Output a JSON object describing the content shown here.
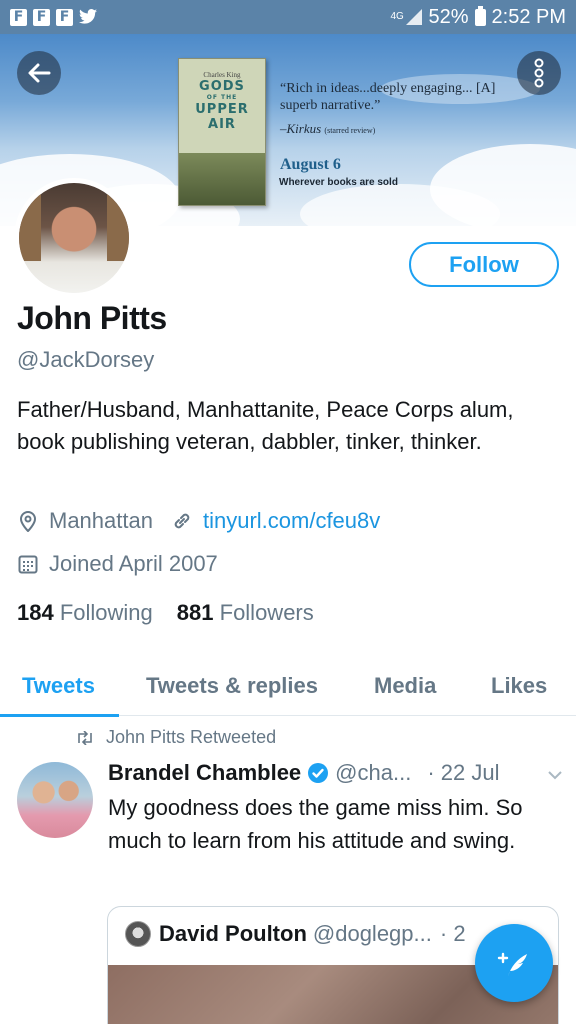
{
  "status_bar": {
    "app_icons": [
      "F",
      "F",
      "F"
    ],
    "network": "4G",
    "battery": "52%",
    "time": "2:52 PM"
  },
  "banner": {
    "book_author": "Charles King",
    "book_title_lines": [
      "GODS",
      "OF THE",
      "UPPER",
      "AIR"
    ],
    "quote": "“Rich in ideas...deeply engaging... [A] superb narrative.”",
    "quote_source": "–Kirkus",
    "quote_source_note": "(starred review)",
    "release_date": "August 6",
    "availability": "Wherever books are sold"
  },
  "profile": {
    "name": "John Pitts",
    "handle": "@JackDorsey",
    "follow_label": "Follow",
    "bio": "Father/Husband, Manhattanite, Peace Corps alum, book publishing veteran, dabbler, tinker, thinker.",
    "location": "Manhattan",
    "website": "tinyurl.com/cfeu8v",
    "joined": "Joined April 2007",
    "following_count": "184",
    "following_label": "Following",
    "followers_count": "881",
    "followers_label": "Followers"
  },
  "tabs": [
    {
      "label": "Tweets",
      "active": true
    },
    {
      "label": "Tweets & replies",
      "active": false
    },
    {
      "label": "Media",
      "active": false
    },
    {
      "label": "Likes",
      "active": false
    }
  ],
  "tweet": {
    "retweet_context": "John Pitts Retweeted",
    "author_name": "Brandel Chamblee",
    "author_handle": "@cha...",
    "time": "· 22 Jul",
    "text": "My goodness does the game miss him. So much to learn from his attitude and swing.",
    "quoted": {
      "author_name": "David Poulton",
      "author_handle": "@doglegp...",
      "time": "· 2"
    }
  },
  "colors": {
    "accent": "#1da1f2",
    "status_bar": "#5b83a8",
    "secondary_text": "#657786"
  },
  "icons": {
    "back": "arrow-left-icon",
    "more": "vertical-dots-icon",
    "location": "map-pin-icon",
    "link": "link-icon",
    "calendar": "calendar-icon",
    "retweet": "retweet-icon",
    "verified": "verified-badge-icon",
    "caret": "chevron-down-icon",
    "compose": "compose-feather-icon"
  }
}
